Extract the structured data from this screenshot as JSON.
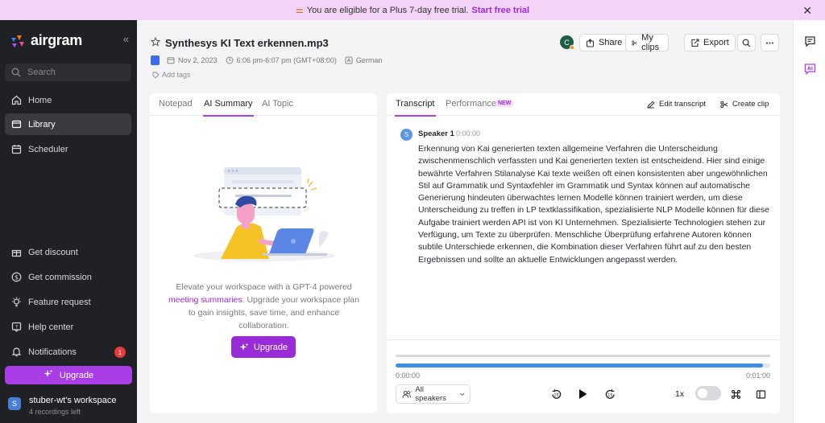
{
  "banner": {
    "text": "You are eligible for a Plus 7-day free trial.",
    "cta": "Start free trial"
  },
  "sidebar": {
    "brand": "airgram",
    "search_placeholder": "Search",
    "items": [
      {
        "label": "Home",
        "icon": "home-icon"
      },
      {
        "label": "Library",
        "icon": "library-icon",
        "active": true
      },
      {
        "label": "Scheduler",
        "icon": "calendar-icon"
      }
    ],
    "bottom_items": [
      {
        "label": "Get discount",
        "icon": "gift-icon"
      },
      {
        "label": "Get commission",
        "icon": "dollar-icon"
      },
      {
        "label": "Feature request",
        "icon": "lightbulb-icon"
      },
      {
        "label": "Help center",
        "icon": "help-icon"
      },
      {
        "label": "Notifications",
        "icon": "bell-icon",
        "badge": "1"
      }
    ],
    "upgrade_label": "Upgrade",
    "workspace": {
      "avatar": "S",
      "name": "stuber-wt's workspace",
      "sub": "4 recordings left"
    }
  },
  "header": {
    "title": "Synthesys KI Text erkennen.mp3",
    "date": "Nov 2, 2023",
    "time": "6:06 pm-6:07 pm (GMT+08:00)",
    "language": "German",
    "add_tags": "Add tags",
    "avatar": "C",
    "share_label": "Share",
    "clips_label": "My clips",
    "export_label": "Export"
  },
  "left_panel": {
    "tabs": [
      "Notepad",
      "AI Summary",
      "AI Topic"
    ],
    "active_tab": "AI Summary",
    "promo_text_1": "Elevate your workspace with  a GPT-4 powered",
    "promo_link": "meeting summaries",
    "promo_text_2": ". Upgrade your workspace plan to gain insights, save time, and enhance collaboration.",
    "upgrade_label": "Upgrade"
  },
  "right_panel": {
    "tabs": [
      "Transcript",
      "Performance"
    ],
    "new_badge": "NEW",
    "edit_transcript": "Edit transcript",
    "create_clip": "Create clip",
    "speaker": {
      "avatar": "S",
      "name": "Speaker 1",
      "time": "0:00:00"
    },
    "transcript": "Erkennung von Kai generierten texten allgemeine Verfahren die Unterscheidung zwischenmenschlich verfassten und Kai generierten texten ist entscheidend. Hier sind einige bewährte Verfahren Stilanalyse Kai texte weißen oft einen konsistenten aber ungewöhnlichen Stil auf Grammatik und Syntaxfehler im Grammatik und Syntax können auf automatische Generierung hindeuten überwachtes lernen Modelle können trainiert werden, um diese Unterscheidung zu treffen in LP textklassifikation, spezialisierte NLP Modelle können für diese Aufgabe trainiert werden API ist von KI Unternehmen. Spezialisierte Technologien stehen zur Verfügung, um Texte zu überprüfen. Menschliche Überprüfung erfahrene Autoren können subtile Unterschiede erkennen, die Kombination dieser Verfahren führt auf zu den besten Ergebnissen und sollte an aktuelle Entwicklungen angepasst werden.",
    "player": {
      "start": "0:00:00",
      "end": "0:01:00",
      "progress": 0.98,
      "speakers_label": "All speakers",
      "rate": "1x"
    }
  },
  "colors": {
    "accent": "#a93ee6",
    "progress": "#3d8fe6",
    "sidebar_bg": "#202124"
  }
}
